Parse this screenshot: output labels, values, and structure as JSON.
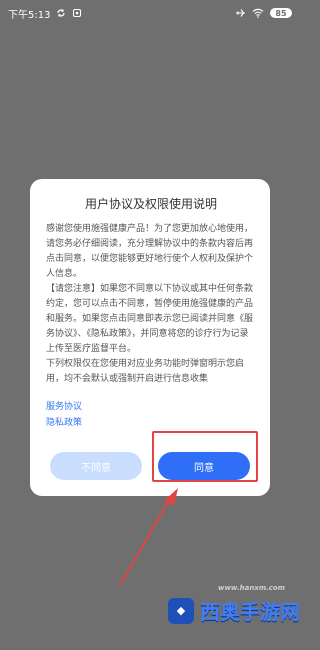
{
  "status_bar": {
    "time": "下午5:13",
    "left_icon": "sync-icon",
    "battery": "85"
  },
  "dialog": {
    "title": "用户协议及权限使用说明",
    "paragraph1": "感谢您使用施强健康产品！为了您更加放心地使用，请您务必仔细阅读，充分理解协议中的条款内容后再点击同意，以便您能够更好地行使个人权利及保护个人信息。",
    "paragraph2": "【请您注意】如果您不同意以下协议或其中任何条款约定，您可以点击不同意，暂停使用施强健康的产品和服务。如果您点击同意即表示您已阅读并同意《服务协议》、《隐私政策》，并同意将您的诊疗行为记录上传至医疗监督平台。",
    "paragraph3": "下列权限仅在您使用对应业务功能时弹窗明示您启用，均不会默认或强制开启进行信息收集",
    "link_service": "服务协议",
    "link_privacy": "隐私政策",
    "btn_disagree": "不同意",
    "btn_agree": "同意"
  },
  "watermark": {
    "logo_label": "◆",
    "text": "西奥手游网",
    "url": "www.hanxm.com"
  },
  "colors": {
    "overlay": "#6f6f6f",
    "accent": "#2f6ef6",
    "highlight": "#e14444"
  }
}
